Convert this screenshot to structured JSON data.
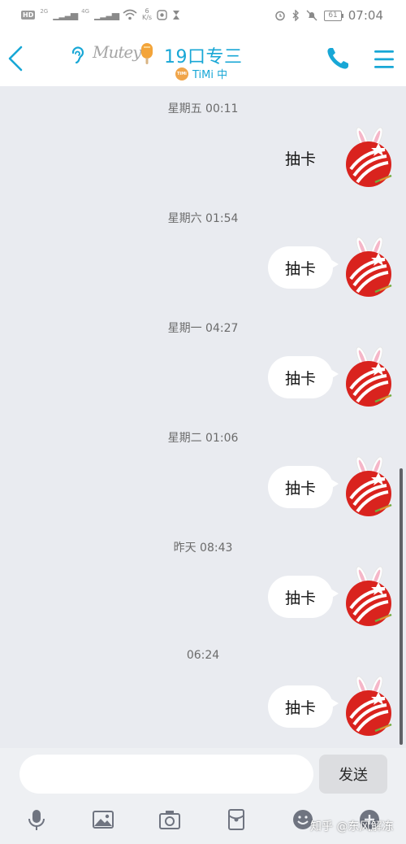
{
  "status_bar": {
    "hd": "HD",
    "sig1": "2G",
    "sig2": "4G",
    "speed_value": "6",
    "speed_unit": "K/s",
    "battery": "61",
    "time": "07:04"
  },
  "header": {
    "brand_text": "Mutey",
    "title": "19口专三",
    "subtitle": "TiMi 中",
    "timi_logo_text": "TiMi"
  },
  "messages": [
    {
      "time": "星期五 00:11",
      "text": "抽卡"
    },
    {
      "time": "星期六 01:54",
      "text": "抽卡"
    },
    {
      "time": "星期一 04:27",
      "text": "抽卡"
    },
    {
      "time": "星期二 01:06",
      "text": "抽卡"
    },
    {
      "time": "昨天 08:43",
      "text": "抽卡"
    },
    {
      "time": "06:24",
      "text": "抽卡"
    }
  ],
  "input": {
    "placeholder": "",
    "send_label": "发送"
  },
  "toolbar_icons": [
    "mic-icon",
    "image-icon",
    "camera-icon",
    "red-packet-icon",
    "emoji-icon",
    "plus-icon"
  ],
  "watermark": "知乎 @东风解冻",
  "colors": {
    "accent": "#18a7d6",
    "avatar_red": "#d9231e",
    "bubble": "#ffffff",
    "chat_bg": "#e9ebf0"
  }
}
